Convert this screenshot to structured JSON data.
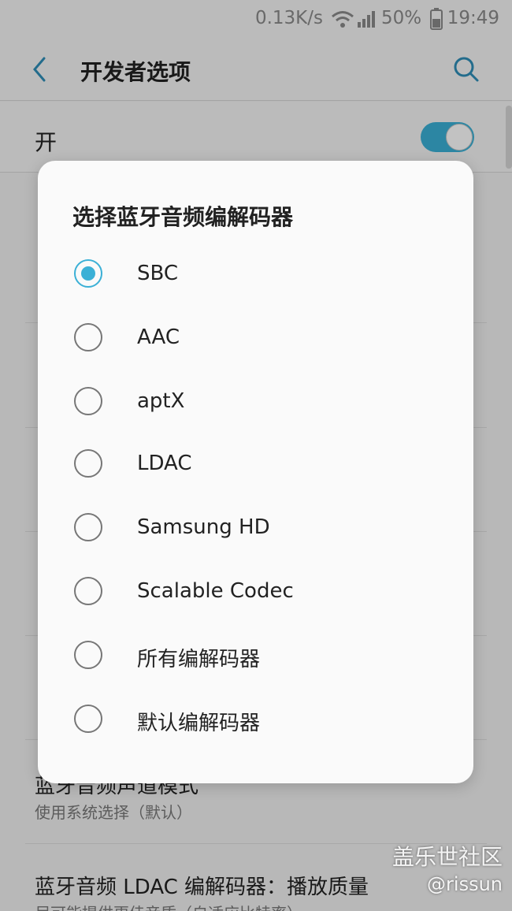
{
  "status_bar": {
    "net_speed": "0.13K/s",
    "battery_percent": "50%",
    "time": "19:49",
    "icons": [
      "wifi-icon",
      "signal-icon",
      "battery-icon"
    ]
  },
  "header": {
    "title": "开发者选项",
    "back_icon": "chevron-left-icon",
    "search_icon": "search-icon"
  },
  "master_switch": {
    "label": "开",
    "state": "on"
  },
  "background_settings": [
    {
      "title": "",
      "summary": ""
    },
    {
      "title": "",
      "summary": ""
    },
    {
      "title": "",
      "summary": ""
    },
    {
      "title": "",
      "summary": ""
    },
    {
      "title": "",
      "summary": ""
    },
    {
      "title": "蓝牙音频声道模式",
      "summary": "使用系统选择（默认）"
    },
    {
      "title": "蓝牙音频 LDAC 编解码器：播放质量",
      "summary": "尽可能提供更佳音质（自适应比特率）"
    }
  ],
  "dialog": {
    "title": "选择蓝牙音频编解码器",
    "selected": "SBC",
    "options": [
      "SBC",
      "AAC",
      "aptX",
      "LDAC",
      "Samsung HD",
      "Scalable Codec",
      "所有编解码器",
      "默认编解码器"
    ]
  },
  "watermark": {
    "title": "盖乐世社区",
    "user": "@rissun"
  },
  "colors": {
    "accent": "#3bb0d6",
    "scrim": "rgba(0,0,0,0.24)",
    "dialog_bg": "#fafafa"
  }
}
